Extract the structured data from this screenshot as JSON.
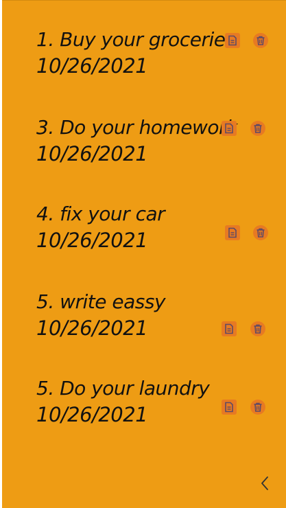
{
  "tasks": [
    {
      "title": "1. Buy your groceries",
      "date": "10/26/2021"
    },
    {
      "title": "3. Do your homework",
      "date": "10/26/2021"
    },
    {
      "title": "4. fix your car",
      "date": "10/26/2021"
    },
    {
      "title": "5. write eassy",
      "date": "10/26/2021"
    },
    {
      "title": "5. Do your laundry",
      "date": "10/26/2021"
    }
  ],
  "icons": {
    "note": "note-icon",
    "delete": "trash-icon",
    "back": "chevron-left-icon"
  },
  "colors": {
    "background": "#EE9C14",
    "icon_bg": "#E77A22",
    "icon_fg": "#5E4A66"
  }
}
